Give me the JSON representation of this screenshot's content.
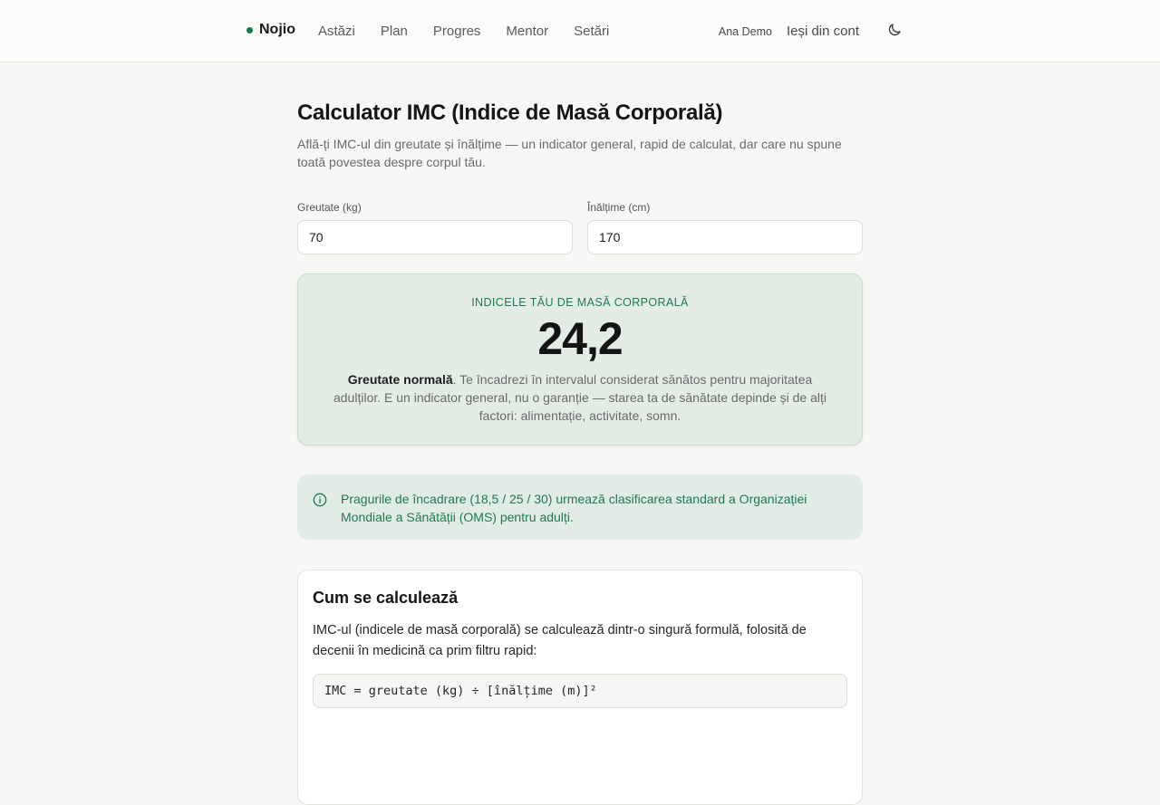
{
  "brand": {
    "name": "Nojio",
    "dot_color": "#137a4d"
  },
  "nav": {
    "items": [
      "Astăzi",
      "Plan",
      "Progres",
      "Mentor",
      "Setări"
    ]
  },
  "user": {
    "name": "Ana Demo",
    "logout": "Ieși din cont",
    "theme_icon": "moon-icon"
  },
  "page": {
    "title": "Calculator IMC (Indice de Masă Corporală)",
    "subtitle": "Află-ți IMC-ul din greutate și înălțime — un indicator general, rapid de calculat, dar care nu spune toată povestea despre corpul tău."
  },
  "form": {
    "weight_label": "Greutate (kg)",
    "weight_value": "70",
    "height_label": "Înălțime (cm)",
    "height_value": "170"
  },
  "result": {
    "label": "INDICELE TĂU DE MASĂ CORPORALĂ",
    "value": "24,2",
    "category": "Greutate normală",
    "description": ". Te încadrezi în intervalul considerat sănătos pentru majoritatea adulților. E un indicator general, nu o garanție — starea ta de sănătate depinde și de alți factori: alimentație, activitate, somn."
  },
  "info": {
    "icon": "info-icon",
    "text": "Pragurile de încadrare (18,5 / 25 / 30) urmează clasificarea standard a Organizației Mondiale a Sănătății (OMS) pentru adulți."
  },
  "how": {
    "title": "Cum se calculează",
    "paragraph": "IMC-ul (indicele de masă corporală) se calculează dintr-o singură formulă, folosită de decenii în medicină ca prim filtru rapid:",
    "formula": "IMC = greutate (kg) ÷ [înălțime (m)]²"
  },
  "colors": {
    "accent": "#1f7a4e",
    "result_bg": "#e3ede6",
    "page_bg": "#f7f7f6"
  }
}
